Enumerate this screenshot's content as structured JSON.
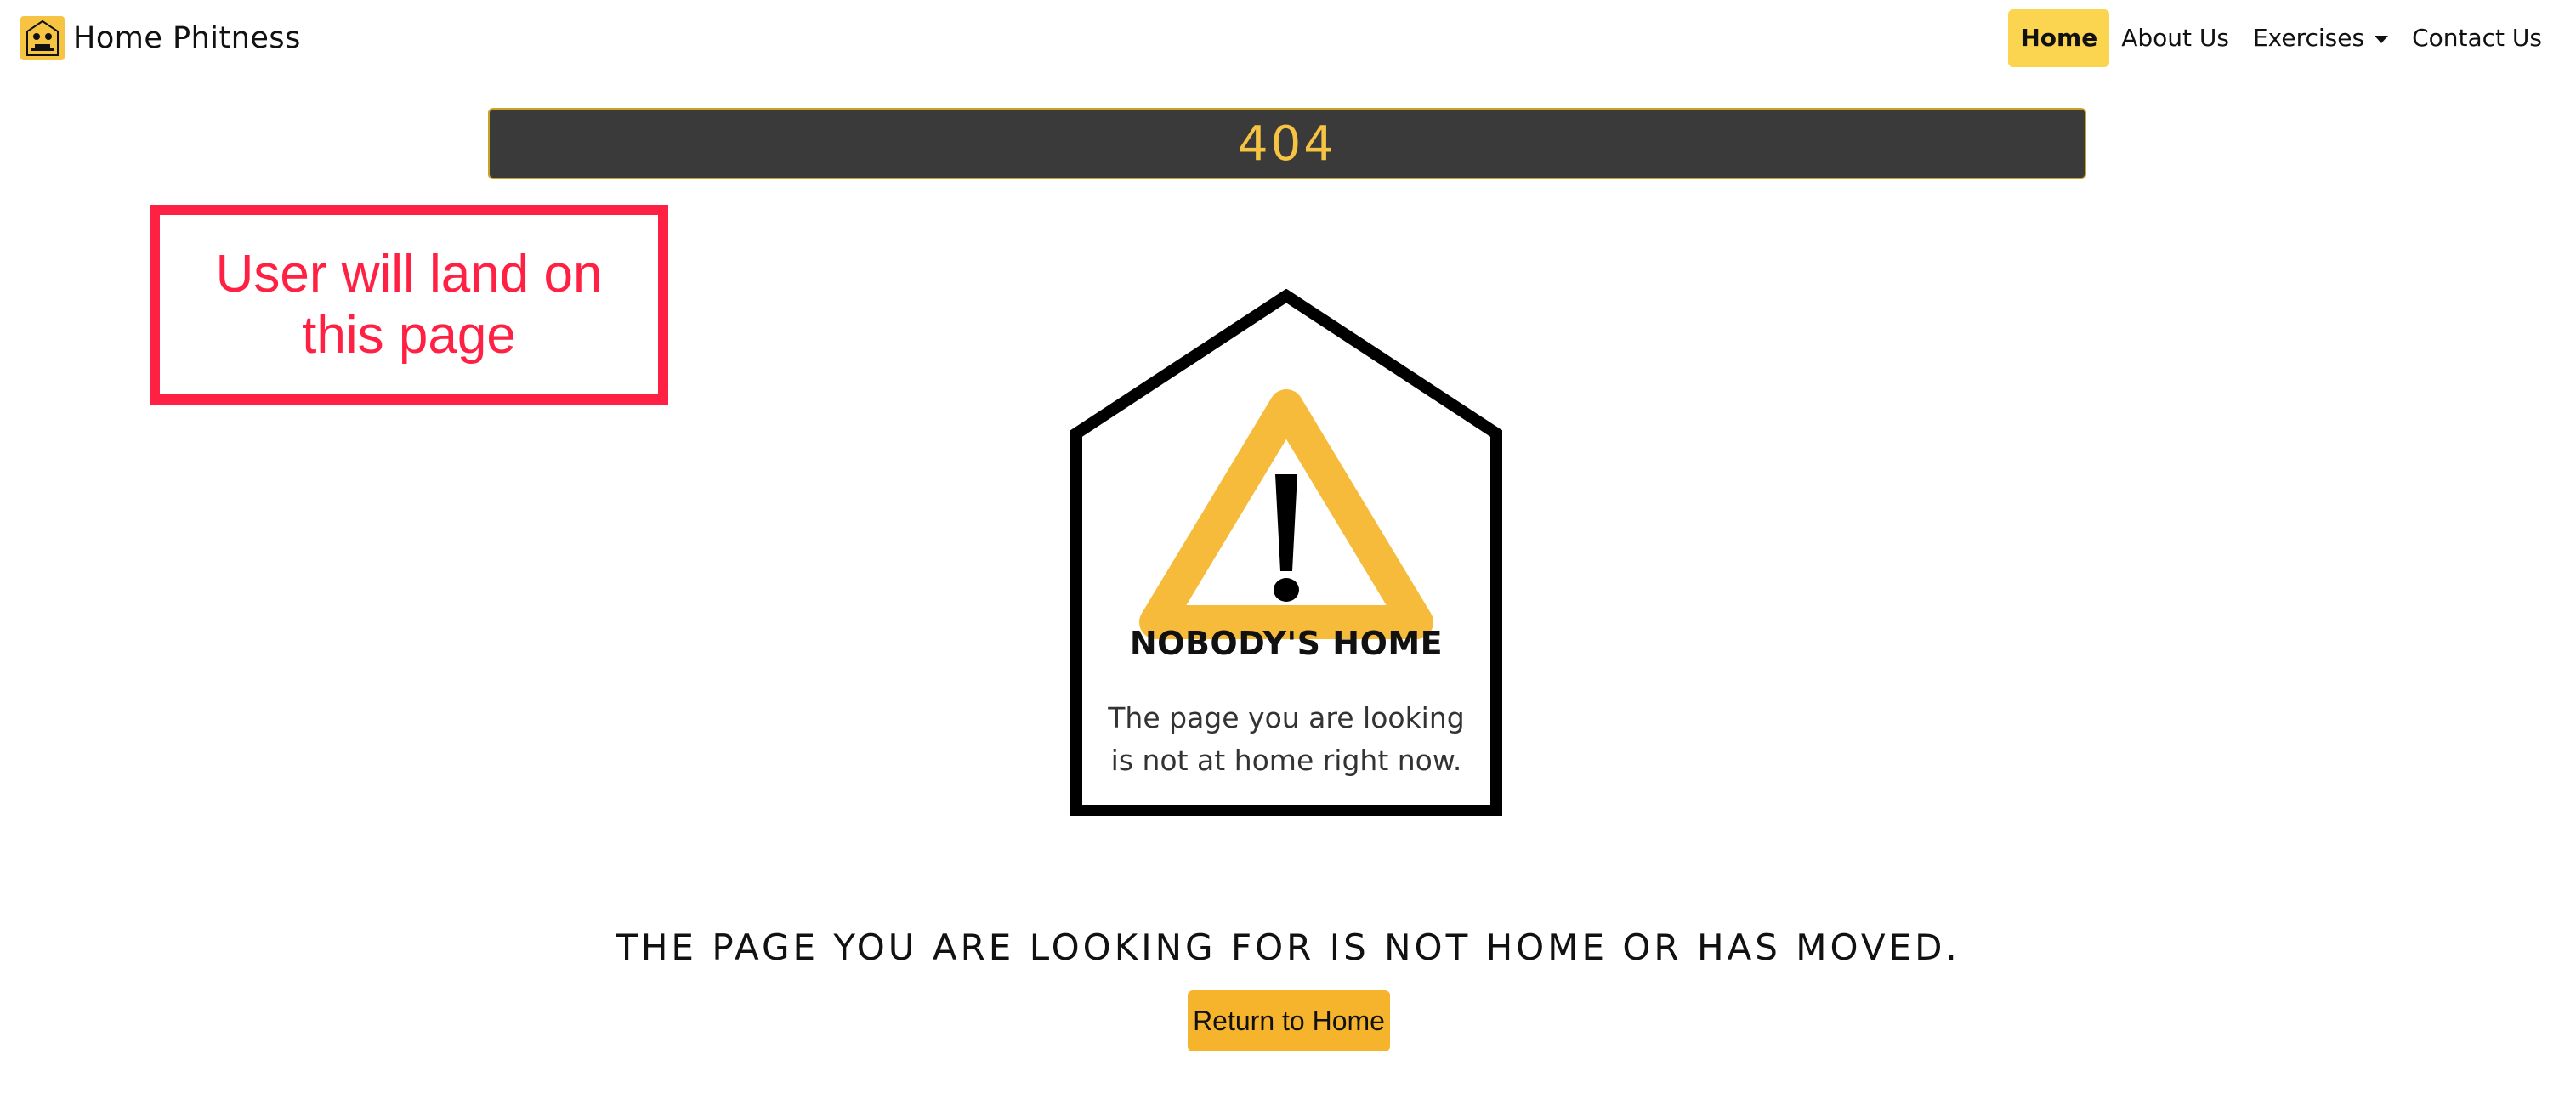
{
  "navbar": {
    "brand_name": "Home Phitness",
    "brand_logo_icon": "fitness-house-logo-icon",
    "links": [
      {
        "label": "Home",
        "active": true
      },
      {
        "label": "About Us",
        "active": false
      },
      {
        "label": "Exercises",
        "active": false,
        "has_dropdown": true
      },
      {
        "label": "Contact Us",
        "active": false
      }
    ]
  },
  "banner": {
    "code": "404"
  },
  "annotation": {
    "text": "User will land on this page"
  },
  "illustration": {
    "icon": "house-warning-icon",
    "title": "NOBODY'S HOME",
    "body": "The page you are looking is not at home right now."
  },
  "message": "THE PAGE YOU ARE LOOKING FOR IS NOT HOME OR HAS MOVED.",
  "return_button_label": "Return to Home",
  "colors": {
    "accent_yellow": "#f6c343",
    "nav_active_bg": "#fbd54f",
    "banner_bg": "#3a3a3a",
    "annotation_red": "#ff2143",
    "button_bg": "#f6b42c"
  }
}
